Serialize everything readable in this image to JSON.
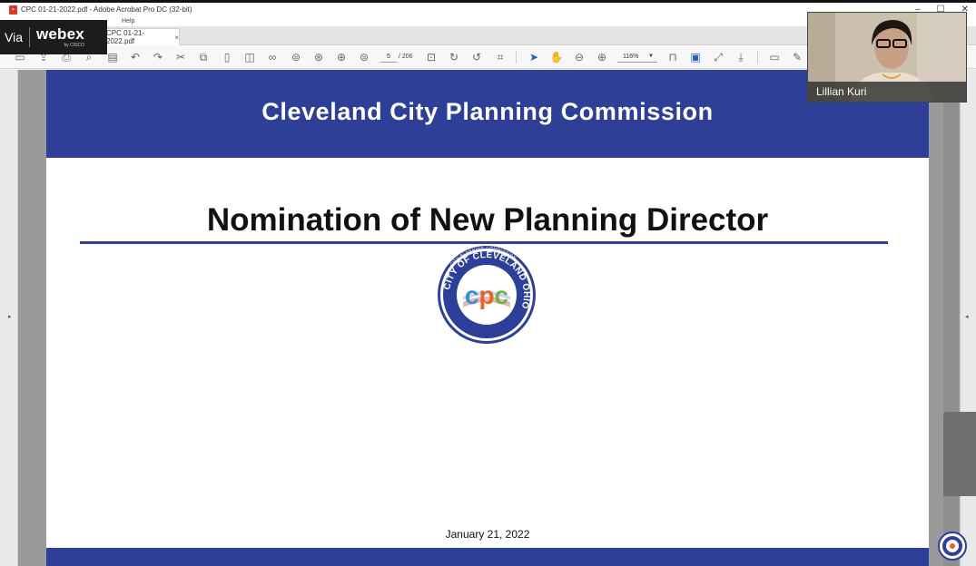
{
  "window": {
    "title": "CPC 01-21-2022.pdf - Adobe Acrobat Pro DC (32-bit)",
    "menu_help": "Help",
    "controls": [
      "–",
      "☐",
      "✕"
    ]
  },
  "tab": {
    "label": "CPC 01-21-2022.pdf",
    "close": "×"
  },
  "toolbar": {
    "page_current": "5",
    "page_total": "/ 206",
    "zoom": "116%"
  },
  "webex": {
    "via": "Via",
    "brand": "webex",
    "sub": "by CISCO"
  },
  "slide": {
    "header": "Cleveland City Planning Commission",
    "title": "Nomination of New Planning Director",
    "seal_ring_top": "CITY PLANNING COMMISSION",
    "seal_ring_main": "CITY OF CLEVELAND OHIO",
    "seal_letters": "cpc",
    "date": "January 21, 2022"
  },
  "participant": {
    "name": "Lillian Kuri"
  },
  "colors": {
    "slide_blue": "#2d3f97",
    "cpc_c1": "#3d8fd1",
    "cpc_p": "#e8622a",
    "cpc_c2": "#6fb34a"
  }
}
